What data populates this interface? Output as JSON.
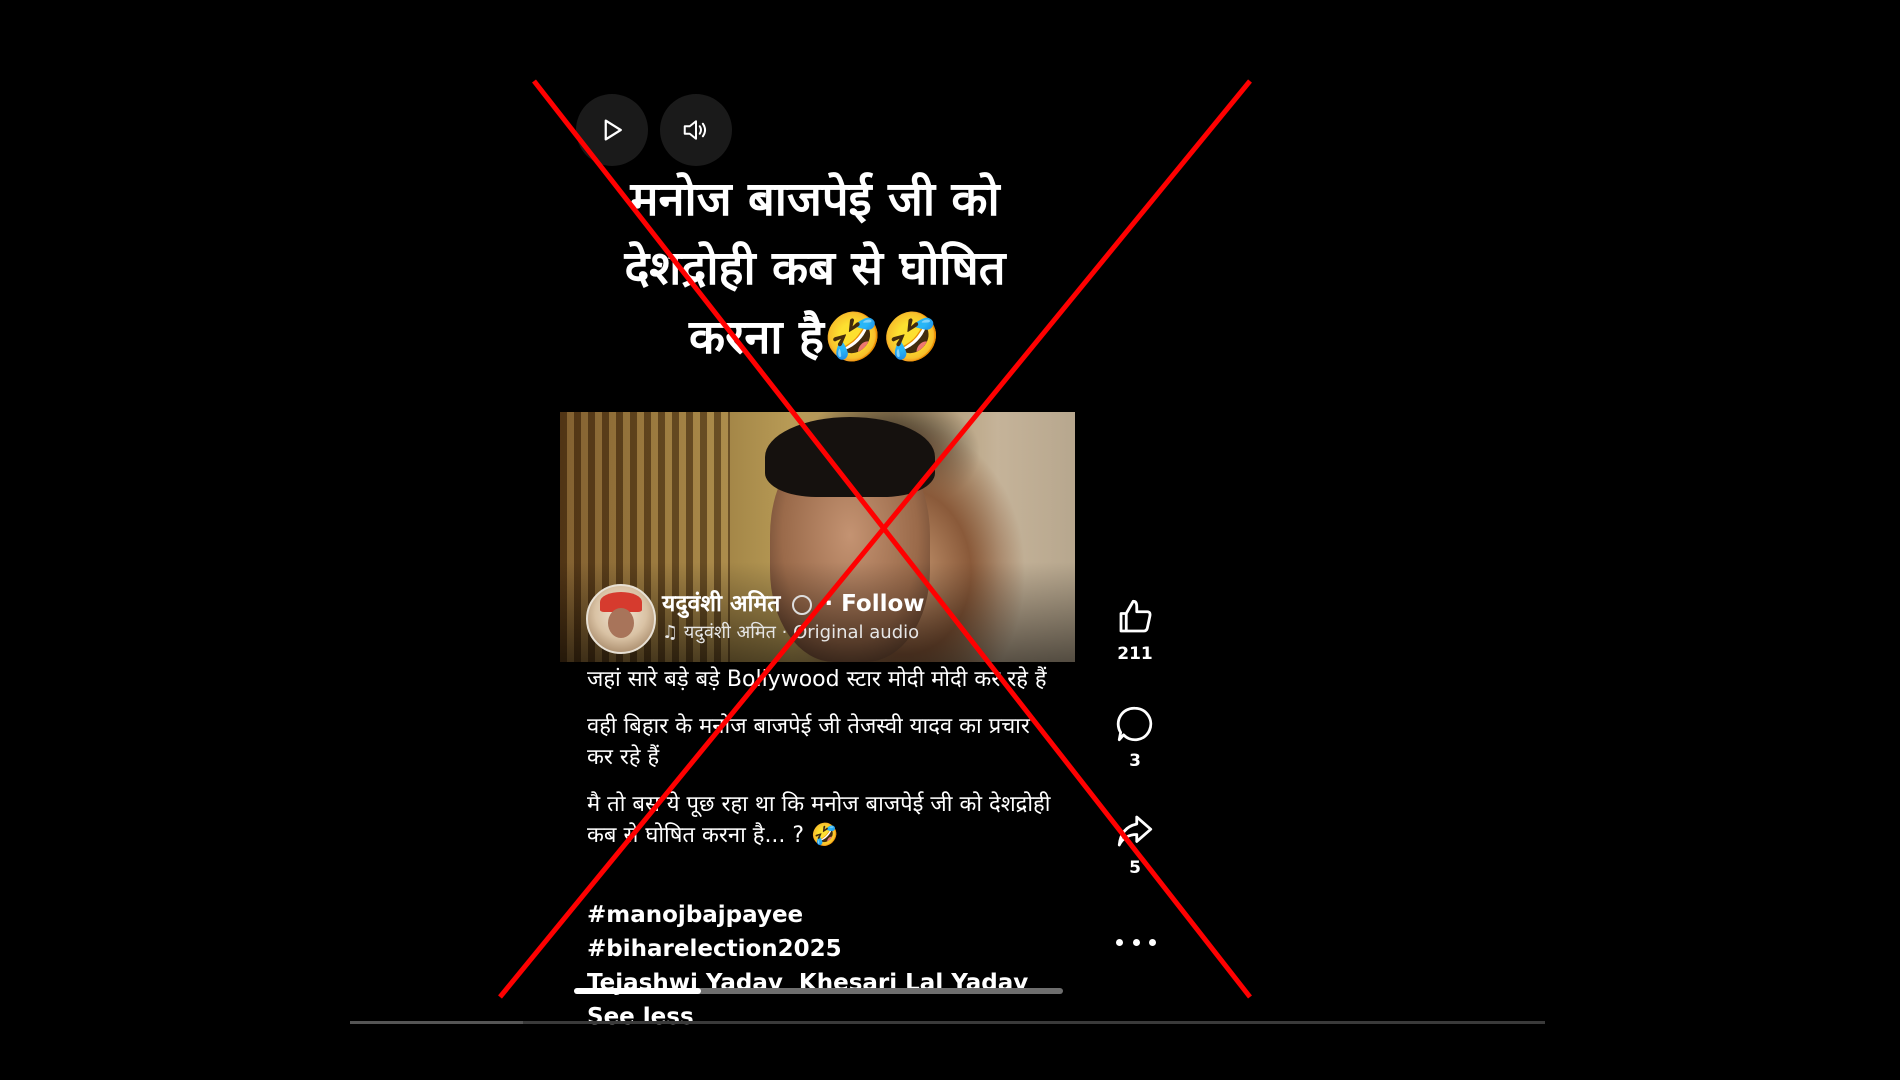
{
  "overlay_text": "मनोज बाजपेई  जी को\nदेशद्रोही कब से घोषित\nकरना है🤣🤣",
  "controls": {
    "play_icon": "play-icon",
    "volume_icon": "volume-icon"
  },
  "author": {
    "name": "यदुवंशी अमित",
    "separator": "·",
    "follow_label": "Follow",
    "audio": "यदुवंशी अमित · Original audio"
  },
  "caption": {
    "paragraphs": [
      "जहां सारे बड़े बड़े Bollywood स्टार मोदी मोदी कर रहे हैं",
      "वही बिहार के मनोज बाजपेई जी तेजस्वी यादव का प्रचार कर रहे हैं",
      "मै तो बस ये पूछ रहा था कि मनोज बाजपेई जी को देशद्रोही कब से घोषित करना है... ? 🤣"
    ]
  },
  "hashtags": {
    "tags": [
      "#manojbajpayee",
      "#biharelection2025"
    ],
    "people": [
      "Tejashwi Yadav",
      "Khesari Lal Yadav"
    ],
    "see_less_label": "See less"
  },
  "actions": {
    "like_count": "211",
    "comment_count": "3",
    "share_count": "5"
  },
  "playback": {
    "progress": 0.26,
    "outer_progress": 0.145
  },
  "colors": {
    "cross": "#ff0000",
    "background": "#000000"
  }
}
